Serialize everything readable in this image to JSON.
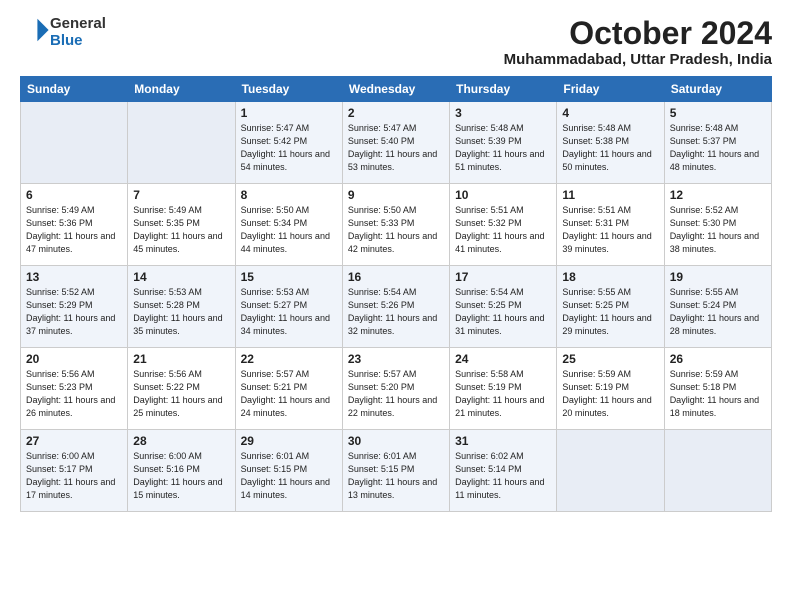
{
  "header": {
    "logo_general": "General",
    "logo_blue": "Blue",
    "month": "October 2024",
    "location": "Muhammadabad, Uttar Pradesh, India"
  },
  "weekdays": [
    "Sunday",
    "Monday",
    "Tuesday",
    "Wednesday",
    "Thursday",
    "Friday",
    "Saturday"
  ],
  "weeks": [
    [
      {
        "day": "",
        "empty": true
      },
      {
        "day": "",
        "empty": true
      },
      {
        "day": "1",
        "sunrise": "5:47 AM",
        "sunset": "5:42 PM",
        "daylight": "11 hours and 54 minutes."
      },
      {
        "day": "2",
        "sunrise": "5:47 AM",
        "sunset": "5:40 PM",
        "daylight": "11 hours and 53 minutes."
      },
      {
        "day": "3",
        "sunrise": "5:48 AM",
        "sunset": "5:39 PM",
        "daylight": "11 hours and 51 minutes."
      },
      {
        "day": "4",
        "sunrise": "5:48 AM",
        "sunset": "5:38 PM",
        "daylight": "11 hours and 50 minutes."
      },
      {
        "day": "5",
        "sunrise": "5:48 AM",
        "sunset": "5:37 PM",
        "daylight": "11 hours and 48 minutes."
      }
    ],
    [
      {
        "day": "6",
        "sunrise": "5:49 AM",
        "sunset": "5:36 PM",
        "daylight": "11 hours and 47 minutes."
      },
      {
        "day": "7",
        "sunrise": "5:49 AM",
        "sunset": "5:35 PM",
        "daylight": "11 hours and 45 minutes."
      },
      {
        "day": "8",
        "sunrise": "5:50 AM",
        "sunset": "5:34 PM",
        "daylight": "11 hours and 44 minutes."
      },
      {
        "day": "9",
        "sunrise": "5:50 AM",
        "sunset": "5:33 PM",
        "daylight": "11 hours and 42 minutes."
      },
      {
        "day": "10",
        "sunrise": "5:51 AM",
        "sunset": "5:32 PM",
        "daylight": "11 hours and 41 minutes."
      },
      {
        "day": "11",
        "sunrise": "5:51 AM",
        "sunset": "5:31 PM",
        "daylight": "11 hours and 39 minutes."
      },
      {
        "day": "12",
        "sunrise": "5:52 AM",
        "sunset": "5:30 PM",
        "daylight": "11 hours and 38 minutes."
      }
    ],
    [
      {
        "day": "13",
        "sunrise": "5:52 AM",
        "sunset": "5:29 PM",
        "daylight": "11 hours and 37 minutes."
      },
      {
        "day": "14",
        "sunrise": "5:53 AM",
        "sunset": "5:28 PM",
        "daylight": "11 hours and 35 minutes."
      },
      {
        "day": "15",
        "sunrise": "5:53 AM",
        "sunset": "5:27 PM",
        "daylight": "11 hours and 34 minutes."
      },
      {
        "day": "16",
        "sunrise": "5:54 AM",
        "sunset": "5:26 PM",
        "daylight": "11 hours and 32 minutes."
      },
      {
        "day": "17",
        "sunrise": "5:54 AM",
        "sunset": "5:25 PM",
        "daylight": "11 hours and 31 minutes."
      },
      {
        "day": "18",
        "sunrise": "5:55 AM",
        "sunset": "5:25 PM",
        "daylight": "11 hours and 29 minutes."
      },
      {
        "day": "19",
        "sunrise": "5:55 AM",
        "sunset": "5:24 PM",
        "daylight": "11 hours and 28 minutes."
      }
    ],
    [
      {
        "day": "20",
        "sunrise": "5:56 AM",
        "sunset": "5:23 PM",
        "daylight": "11 hours and 26 minutes."
      },
      {
        "day": "21",
        "sunrise": "5:56 AM",
        "sunset": "5:22 PM",
        "daylight": "11 hours and 25 minutes."
      },
      {
        "day": "22",
        "sunrise": "5:57 AM",
        "sunset": "5:21 PM",
        "daylight": "11 hours and 24 minutes."
      },
      {
        "day": "23",
        "sunrise": "5:57 AM",
        "sunset": "5:20 PM",
        "daylight": "11 hours and 22 minutes."
      },
      {
        "day": "24",
        "sunrise": "5:58 AM",
        "sunset": "5:19 PM",
        "daylight": "11 hours and 21 minutes."
      },
      {
        "day": "25",
        "sunrise": "5:59 AM",
        "sunset": "5:19 PM",
        "daylight": "11 hours and 20 minutes."
      },
      {
        "day": "26",
        "sunrise": "5:59 AM",
        "sunset": "5:18 PM",
        "daylight": "11 hours and 18 minutes."
      }
    ],
    [
      {
        "day": "27",
        "sunrise": "6:00 AM",
        "sunset": "5:17 PM",
        "daylight": "11 hours and 17 minutes."
      },
      {
        "day": "28",
        "sunrise": "6:00 AM",
        "sunset": "5:16 PM",
        "daylight": "11 hours and 15 minutes."
      },
      {
        "day": "29",
        "sunrise": "6:01 AM",
        "sunset": "5:15 PM",
        "daylight": "11 hours and 14 minutes."
      },
      {
        "day": "30",
        "sunrise": "6:01 AM",
        "sunset": "5:15 PM",
        "daylight": "11 hours and 13 minutes."
      },
      {
        "day": "31",
        "sunrise": "6:02 AM",
        "sunset": "5:14 PM",
        "daylight": "11 hours and 11 minutes."
      },
      {
        "day": "",
        "empty": true
      },
      {
        "day": "",
        "empty": true
      }
    ]
  ]
}
